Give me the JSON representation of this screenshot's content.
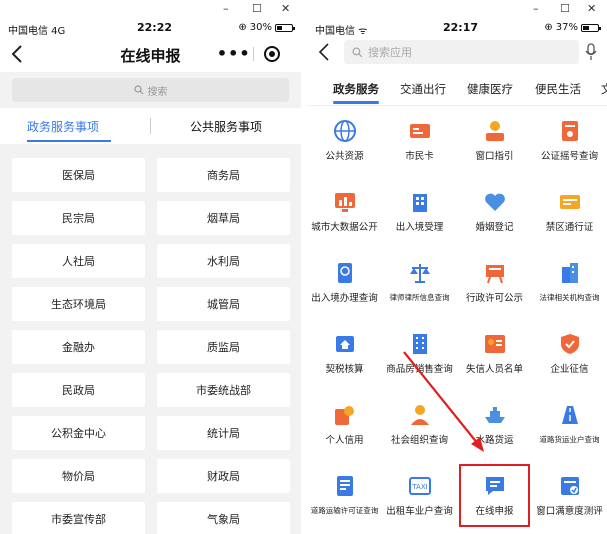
{
  "left": {
    "status": {
      "carrier": "中国电信  4G",
      "time": "22:22",
      "battery": "30%",
      "battery_level": 0.3
    },
    "nav": {
      "title": "在线申报",
      "more": "•••"
    },
    "search": {
      "placeholder": "搜索"
    },
    "tabs": [
      {
        "label": "政务服务事项"
      },
      {
        "label": "公共服务事项"
      }
    ],
    "grid": [
      [
        "医保局",
        "商务局"
      ],
      [
        "民宗局",
        "烟草局"
      ],
      [
        "人社局",
        "水利局"
      ],
      [
        "生态环境局",
        "城管局"
      ],
      [
        "金融办",
        "质监局"
      ],
      [
        "民政局",
        "市委统战部"
      ],
      [
        "公积金中心",
        "统计局"
      ],
      [
        "物价局",
        "财政局"
      ],
      [
        "市委宣传部",
        "气象局"
      ]
    ]
  },
  "right": {
    "status": {
      "carrier": "中国电信",
      "time": "22:17",
      "battery": "37%",
      "battery_level": 0.37
    },
    "search": {
      "placeholder": "搜索应用"
    },
    "tabs": [
      "政务服务",
      "交通出行",
      "健康医疗",
      "便民生活",
      "文"
    ],
    "apps": [
      {
        "label": "公共资源",
        "icon": "globe-icon",
        "color": "#3a7ae6"
      },
      {
        "label": "市民卡",
        "icon": "id-card-icon",
        "color": "#f0683a"
      },
      {
        "label": "窗口指引",
        "icon": "service-person-icon",
        "color": "#f5a623"
      },
      {
        "label": "公证摇号查询",
        "icon": "lottery-doc-icon",
        "color": "#f0683a"
      },
      {
        "label": "城市大数据公开",
        "icon": "bar-chart-icon",
        "color": "#f0683a"
      },
      {
        "label": "出入境受理",
        "icon": "building-icon",
        "color": "#3a7ae6"
      },
      {
        "label": "婚姻登记",
        "icon": "heart-icon",
        "color": "#4a90e2"
      },
      {
        "label": "禁区通行证",
        "icon": "permit-icon",
        "color": "#f5a623"
      },
      {
        "label": "出入境办理查询",
        "icon": "passport-icon",
        "color": "#3a7ae6"
      },
      {
        "label": "律师律所信息查询",
        "icon": "scales-icon",
        "color": "#3a7ae6"
      },
      {
        "label": "行政许可公示",
        "icon": "notice-board-icon",
        "color": "#f0683a"
      },
      {
        "label": "法律相关机构查询",
        "icon": "office-icon",
        "color": "#3a7ae6"
      },
      {
        "label": "契税核算",
        "icon": "house-calc-icon",
        "color": "#3a7ae6"
      },
      {
        "label": "商品房销售查询",
        "icon": "apartment-icon",
        "color": "#3a7ae6"
      },
      {
        "label": "失信人员名单",
        "icon": "person-list-icon",
        "color": "#f5a623"
      },
      {
        "label": "企业征信",
        "icon": "shield-icon",
        "color": "#f0683a"
      },
      {
        "label": "个人信用",
        "icon": "person-credit-icon",
        "color": "#f5a623"
      },
      {
        "label": "社会组织查询",
        "icon": "group-icon",
        "color": "#f5a623"
      },
      {
        "label": "水路货运",
        "icon": "ship-icon",
        "color": "#4a90e2"
      },
      {
        "label": "道路货运业户查询",
        "icon": "road-icon",
        "color": "#3a7ae6"
      },
      {
        "label": "道路运输许可证查询",
        "icon": "license-icon",
        "color": "#3a7ae6"
      },
      {
        "label": "出租车业户查询",
        "icon": "taxi-icon",
        "color": "#3a7ae6"
      },
      {
        "label": "在线申报",
        "icon": "chat-doc-icon",
        "color": "#3a7ae6"
      },
      {
        "label": "窗口满意度测评",
        "icon": "rating-doc-icon",
        "color": "#3a7ae6"
      }
    ]
  },
  "annotation": {
    "color": "#e02020",
    "target": "在线申报"
  }
}
